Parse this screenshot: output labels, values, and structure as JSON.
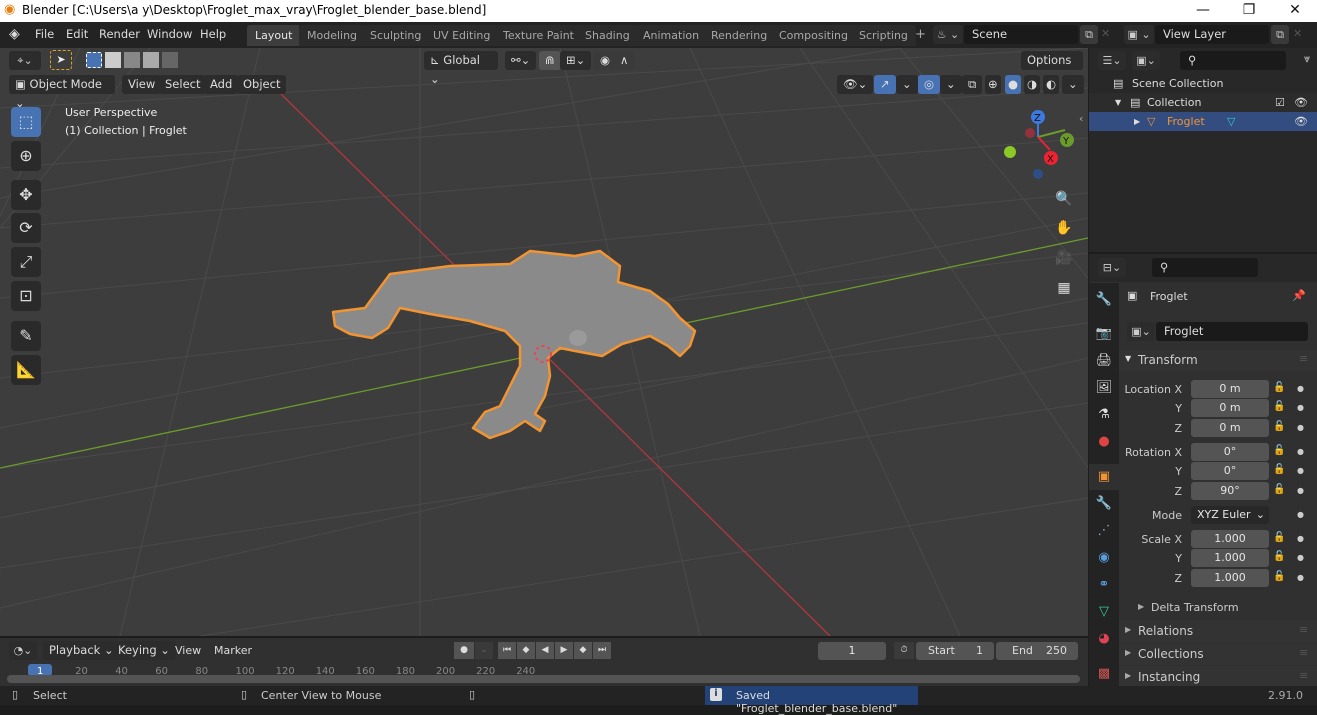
{
  "window": {
    "title": "Blender [C:\\Users\\a y\\Desktop\\Froglet_max_vray\\Froglet_blender_base.blend]",
    "controls": {
      "minimize": "—",
      "maximize": "❐",
      "close": "✕"
    }
  },
  "menu": [
    "File",
    "Edit",
    "Render",
    "Window",
    "Help"
  ],
  "workspaces": [
    "Layout",
    "Modeling",
    "Sculpting",
    "UV Editing",
    "Texture Paint",
    "Shading",
    "Animation",
    "Rendering",
    "Compositing",
    "Scripting"
  ],
  "active_workspace": "Layout",
  "add_workspace": "+",
  "scene": {
    "name": "Scene"
  },
  "view_layer": {
    "name": "View Layer"
  },
  "viewport": {
    "mode": "Object Mode",
    "menus": [
      "View",
      "Select",
      "Add",
      "Object"
    ],
    "transform_orientation": "Global",
    "options_label": "Options",
    "overlay_text": {
      "view": "User Perspective",
      "context": "(1) Collection | Froglet"
    },
    "gizmo": {
      "z": "Z",
      "y": "Y",
      "x": "X"
    },
    "colors": {
      "x_axis": "#b3363f",
      "y_axis": "#6b9c2b",
      "selection_outline": "#f29432",
      "active_tool": "#4772b3"
    }
  },
  "outliner": {
    "search_placeholder": "",
    "items": [
      {
        "label": "Scene Collection",
        "level": 0
      },
      {
        "label": "Collection",
        "level": 1
      },
      {
        "label": "Froglet",
        "level": 2,
        "selected": true
      }
    ]
  },
  "properties": {
    "object_name": "Froglet",
    "data_name": "Froglet",
    "transform_header": "Transform",
    "location": {
      "label": "Location X",
      "x": "0 m",
      "y": "0 m",
      "z": "0 m"
    },
    "rotation": {
      "label": "Rotation X",
      "x": "0°",
      "y": "0°",
      "z": "90°"
    },
    "mode": {
      "label": "Mode",
      "value": "XYZ Euler"
    },
    "scale": {
      "label": "Scale X",
      "x": "1.000",
      "y": "1.000",
      "z": "1.000"
    },
    "axis_labels": {
      "y": "Y",
      "z": "Z"
    },
    "subsections": [
      "Delta Transform"
    ],
    "panels": [
      "Relations",
      "Collections",
      "Instancing"
    ]
  },
  "timeline": {
    "menus": [
      "Playback",
      "Keying",
      "View",
      "Marker"
    ],
    "current_frame": "1",
    "start_label": "Start",
    "start": "1",
    "end_label": "End",
    "end": "250",
    "ticks": [
      "1",
      "20",
      "40",
      "60",
      "80",
      "100",
      "120",
      "140",
      "160",
      "180",
      "200",
      "220",
      "240"
    ]
  },
  "statusbar": {
    "left": "Select",
    "middle": "Center View to Mouse",
    "message": "Saved \"Froglet_blender_base.blend\"",
    "version": "2.91.0"
  }
}
